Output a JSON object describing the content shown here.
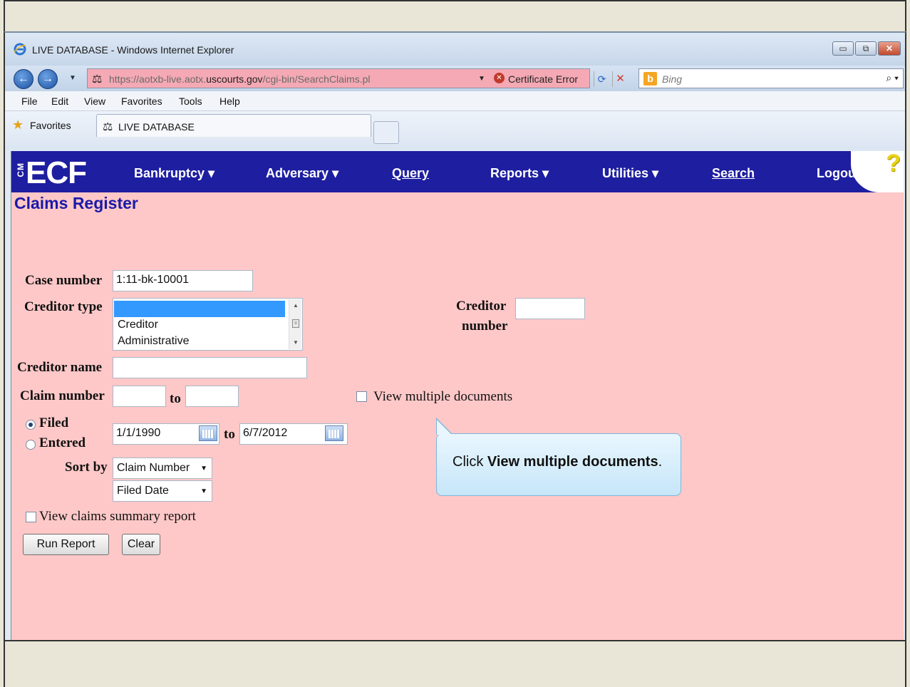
{
  "window": {
    "title": "LIVE DATABASE - Windows Internet Explorer",
    "minimize": "▭",
    "restore": "⧉",
    "close": "✕"
  },
  "addressbar": {
    "url_prefix": "https://aotxb-live.aotx.",
    "url_domain": "uscourts.gov",
    "url_path": "/cgi-bin/SearchClaims.pl",
    "cert_error": "Certificate Error",
    "search_placeholder": "Bing"
  },
  "menubar": [
    "File",
    "Edit",
    "View",
    "Favorites",
    "Tools",
    "Help"
  ],
  "favorites": {
    "label": "Favorites",
    "tab_title": "LIVE DATABASE"
  },
  "ecf_nav": {
    "logo_prefix": "CM",
    "logo": "ECF",
    "bankruptcy": "Bankruptcy",
    "adversary": "Adversary",
    "query": "Query",
    "reports": "Reports",
    "utilities": "Utilities",
    "search": "Search",
    "logout": "Logout",
    "help": "?"
  },
  "page": {
    "title": "Claims Register"
  },
  "form": {
    "case_number_label": "Case number",
    "case_number_value": "1:11-bk-10001",
    "creditor_type_label": "Creditor type",
    "creditor_type_options": [
      "",
      "Creditor",
      "Administrative"
    ],
    "creditor_number_label_1": "Creditor",
    "creditor_number_label_2": "number",
    "creditor_name_label": "Creditor name",
    "claim_number_label": "Claim number",
    "to_label": "to",
    "view_multiple_label": "View multiple documents",
    "filed_label": "Filed",
    "entered_label": "Entered",
    "date_from": "1/1/1990",
    "date_to": "6/7/2012",
    "sort_by_label": "Sort by",
    "sort_primary": "Claim Number",
    "sort_secondary": "Filed Date",
    "summary_report_label": "View claims summary report",
    "run_report": "Run Report",
    "clear": "Clear"
  },
  "callout": {
    "prefix": "Click ",
    "emphasis": "View multiple documents",
    "suffix": "."
  }
}
